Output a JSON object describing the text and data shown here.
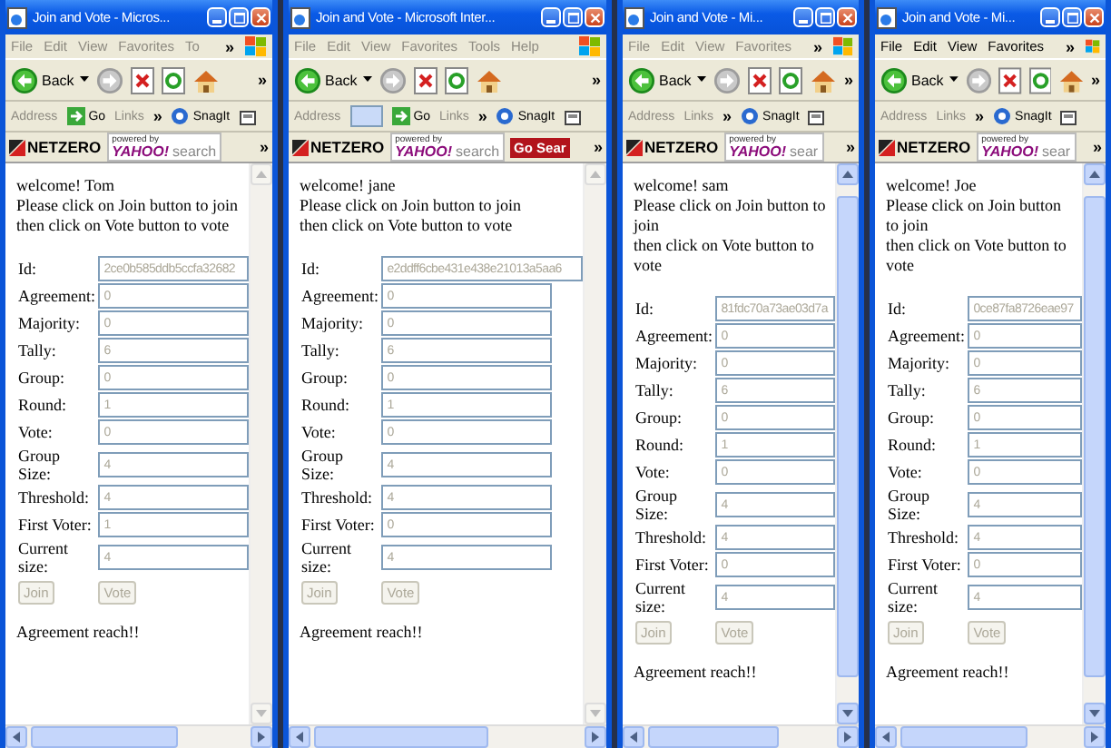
{
  "windows": [
    {
      "title": "Join and Vote - Micros...",
      "active": false,
      "menu": [
        "File",
        "Edit",
        "View",
        "Favorites",
        "To"
      ],
      "menu_more": "»",
      "back": "Back",
      "toolbar_more": "»",
      "address_bar": [
        {
          "kind": "label",
          "text": "Address"
        },
        {
          "kind": "go",
          "text": "Go"
        },
        {
          "kind": "label",
          "text": "Links"
        },
        {
          "kind": "more",
          "text": "»"
        },
        {
          "kind": "snagit",
          "text": "SnagIt"
        }
      ],
      "search_bar": {
        "brand": "NETZERO",
        "powered": "powered by",
        "engine": "YAHOO!",
        "search": "search",
        "more": "»"
      },
      "scrollable": false,
      "welcome": "welcome! Tom",
      "instructions": [
        "Please click on Join button to join",
        "then click on Vote button to vote"
      ],
      "fields": [
        {
          "label": "Id:",
          "value": "2ce0b585ddb5ccfa32682",
          "disabled": true
        },
        {
          "label": "Agreement:",
          "value": "0",
          "disabled": true
        },
        {
          "label": "Majority:",
          "value": "0",
          "disabled": true
        },
        {
          "label": "Tally:",
          "value": "6",
          "disabled": true
        },
        {
          "label": "Group:",
          "value": "0",
          "disabled": true
        },
        {
          "label": "Round:",
          "value": "1",
          "disabled": true
        },
        {
          "label": "Vote:",
          "value": "0",
          "disabled": true
        },
        {
          "label": "Group Size:",
          "value": "4",
          "disabled": true
        },
        {
          "label": "Threshold:",
          "value": "4",
          "disabled": true
        },
        {
          "label": "First Voter:",
          "value": "1",
          "disabled": true
        },
        {
          "label": "Current size:",
          "value": "4",
          "disabled": true
        }
      ],
      "buttons": [
        {
          "label": "Join",
          "disabled": true
        },
        {
          "label": "Vote",
          "disabled": true
        }
      ],
      "message": "Agreement reach!!"
    },
    {
      "title": "Join and Vote - Microsoft Inter...",
      "active": false,
      "menu": [
        "File",
        "Edit",
        "View",
        "Favorites",
        "Tools",
        "Help"
      ],
      "back": "Back",
      "toolbar_more": "»",
      "address_bar": [
        {
          "kind": "label",
          "text": "Address"
        },
        {
          "kind": "dropdown"
        },
        {
          "kind": "go",
          "text": "Go"
        },
        {
          "kind": "label",
          "text": "Links"
        },
        {
          "kind": "more",
          "text": "»"
        },
        {
          "kind": "snagit",
          "text": "SnagIt"
        }
      ],
      "search_bar": {
        "brand": "NETZERO",
        "powered": "powered by",
        "engine": "YAHOO!",
        "search": "search",
        "button": "Go Sear",
        "more": "»"
      },
      "scrollable": false,
      "welcome": "welcome! jane",
      "instructions": [
        "Please click on Join button to join",
        "then click on Vote button to vote"
      ],
      "fields": [
        {
          "label": "Id:",
          "value": "e2ddff6cbe431e438e21013a5aa6",
          "disabled": true
        },
        {
          "label": "Agreement:",
          "value": "0",
          "disabled": true
        },
        {
          "label": "Majority:",
          "value": "0",
          "disabled": true
        },
        {
          "label": "Tally:",
          "value": "6",
          "disabled": true
        },
        {
          "label": "Group:",
          "value": "0",
          "disabled": true
        },
        {
          "label": "Round:",
          "value": "1",
          "disabled": true
        },
        {
          "label": "Vote:",
          "value": "0",
          "disabled": true
        },
        {
          "label": "Group Size:",
          "value": "4",
          "disabled": true
        },
        {
          "label": "Threshold:",
          "value": "4",
          "disabled": true
        },
        {
          "label": "First Voter:",
          "value": "0",
          "disabled": true
        },
        {
          "label": "Current size:",
          "value": "4",
          "disabled": true
        }
      ],
      "buttons": [
        {
          "label": "Join",
          "disabled": true
        },
        {
          "label": "Vote",
          "disabled": true
        }
      ],
      "message": "Agreement reach!!"
    },
    {
      "title": "Join and Vote - Mi...",
      "active": false,
      "menu": [
        "File",
        "Edit",
        "View",
        "Favorites"
      ],
      "menu_more": "»",
      "back": "Back",
      "toolbar_more": "»",
      "address_bar": [
        {
          "kind": "label",
          "text": "Address"
        },
        {
          "kind": "label",
          "text": "Links"
        },
        {
          "kind": "more",
          "text": "»"
        },
        {
          "kind": "snagit",
          "text": "SnagIt"
        }
      ],
      "search_bar": {
        "brand": "NETZERO",
        "powered": "powered by",
        "engine": "YAHOO!",
        "search": "sear",
        "more": "»"
      },
      "scrollable": true,
      "welcome": "welcome! sam",
      "instructions": [
        "Please click on Join button to join",
        "then click on Vote button to vote"
      ],
      "fields": [
        {
          "label": "Id:",
          "value": "81fdc70a73ae03d7a",
          "disabled": true
        },
        {
          "label": "Agreement:",
          "value": "0",
          "disabled": true
        },
        {
          "label": "Majority:",
          "value": "0",
          "disabled": true
        },
        {
          "label": "Tally:",
          "value": "6",
          "disabled": true
        },
        {
          "label": "Group:",
          "value": "0",
          "disabled": true
        },
        {
          "label": "Round:",
          "value": "1",
          "disabled": true
        },
        {
          "label": "Vote:",
          "value": "0",
          "disabled": true
        },
        {
          "label": "Group Size:",
          "value": "4",
          "disabled": true
        },
        {
          "label": "Threshold:",
          "value": "4",
          "disabled": true
        },
        {
          "label": "First Voter:",
          "value": "0",
          "disabled": true
        },
        {
          "label": "Current size:",
          "value": "4",
          "disabled": true
        }
      ],
      "buttons": [
        {
          "label": "Join",
          "disabled": true
        },
        {
          "label": "Vote",
          "disabled": true
        }
      ],
      "message": "Agreement reach!!"
    },
    {
      "title": "Join and Vote - Mi...",
      "active": true,
      "menu": [
        "File",
        "Edit",
        "View",
        "Favorites"
      ],
      "menu_more": "»",
      "back": "Back",
      "toolbar_more": "»",
      "address_bar": [
        {
          "kind": "label",
          "text": "Address"
        },
        {
          "kind": "label",
          "text": "Links"
        },
        {
          "kind": "more",
          "text": "»"
        },
        {
          "kind": "snagit",
          "text": "SnagIt"
        }
      ],
      "search_bar": {
        "brand": "NETZERO",
        "powered": "powered by",
        "engine": "YAHOO!",
        "search": "sear",
        "more": "»"
      },
      "scrollable": true,
      "welcome": "welcome! Joe",
      "instructions": [
        "Please click on Join button to join",
        "then click on Vote button to vote"
      ],
      "fields": [
        {
          "label": "Id:",
          "value": "0ce87fa8726eae97",
          "disabled": true
        },
        {
          "label": "Agreement:",
          "value": "0",
          "disabled": true
        },
        {
          "label": "Majority:",
          "value": "0",
          "disabled": true
        },
        {
          "label": "Tally:",
          "value": "6",
          "disabled": true
        },
        {
          "label": "Group:",
          "value": "0",
          "disabled": true
        },
        {
          "label": "Round:",
          "value": "1",
          "disabled": true
        },
        {
          "label": "Vote:",
          "value": "0",
          "disabled": true
        },
        {
          "label": "Group Size:",
          "value": "4",
          "disabled": true
        },
        {
          "label": "Threshold:",
          "value": "4",
          "disabled": true
        },
        {
          "label": "First Voter:",
          "value": "0",
          "disabled": true
        },
        {
          "label": "Current size:",
          "value": "4",
          "disabled": true
        }
      ],
      "buttons": [
        {
          "label": "Join",
          "disabled": true
        },
        {
          "label": "Vote",
          "disabled": true
        }
      ],
      "message": "Agreement reach!!"
    }
  ]
}
